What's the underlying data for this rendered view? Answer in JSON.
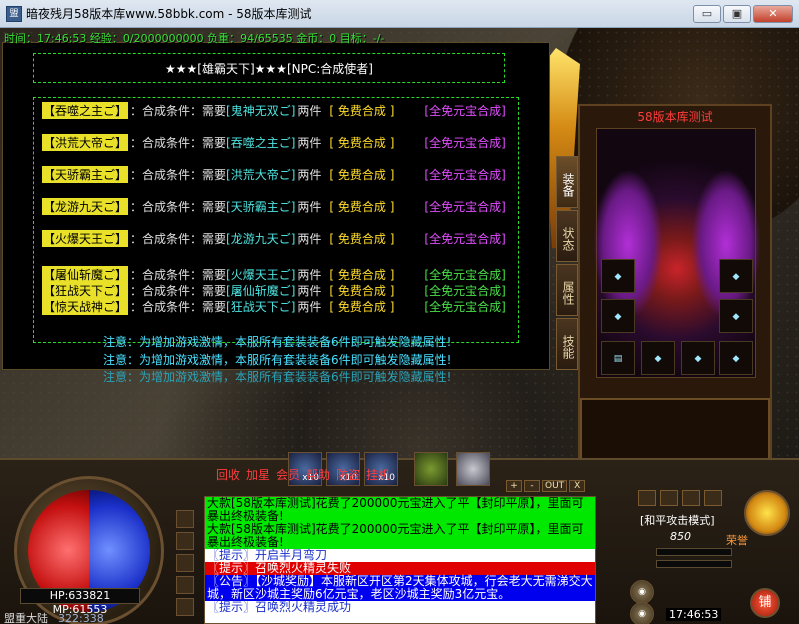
{
  "window": {
    "title": "暗夜残月58版本库www.58bbk.com - 58版本库测试",
    "buttons": {
      "minimize": "▭",
      "maximize": "▣",
      "close": "✕"
    }
  },
  "status_line": "时间：17:46:53 经验：0/2000000000 负重：94/65535 金币：0 目标：-/-",
  "npc_dialog": {
    "header": "★★★[雄霸天下]★★★[NPC:合成使者]",
    "rows": [
      {
        "name": "【吞噬之主ご】",
        "cond": "：合成条件：需要",
        "mat": "[鬼神无双ご]",
        "count": "两件",
        "free": "[ 免费合成 ]",
        "allfree": "[全免元宝合成]",
        "allfree_color": "#e34dff"
      },
      {
        "name": "【洪荒大帝ご】",
        "cond": "：合成条件：需要",
        "mat": "[吞噬之主ご]",
        "count": "两件",
        "free": "[ 免费合成 ]",
        "allfree": "[全免元宝合成]",
        "allfree_color": "#e34dff"
      },
      {
        "name": "【天骄霸主ご】",
        "cond": "：合成条件：需要",
        "mat": "[洪荒大帝ご]",
        "count": "两件",
        "free": "[ 免费合成 ]",
        "allfree": "[全免元宝合成]",
        "allfree_color": "#e34dff"
      },
      {
        "name": "【龙游九天ご】",
        "cond": "：合成条件：需要",
        "mat": "[天骄霸主ご]",
        "count": "两件",
        "free": "[ 免费合成 ]",
        "allfree": "[全免元宝合成]",
        "allfree_color": "#e34dff"
      },
      {
        "name": "【火爆天王ご】",
        "cond": "：合成条件：需要",
        "mat": "[龙游九天ご]",
        "count": "两件",
        "free": "[ 免费合成 ]",
        "allfree": "[全免元宝合成]",
        "allfree_color": "#e34dff"
      },
      {
        "name": "【屠仙斩魔ご】",
        "cond": "：合成条件：需要",
        "mat": "[火爆天王ご]",
        "count": "两件",
        "free": "[ 免费合成 ]",
        "allfree": "[全免元宝合成]",
        "allfree_color": "#48e048"
      },
      {
        "name": "【狂战天下ご】",
        "cond": "：合成条件：需要",
        "mat": "[屠仙斩魔ご]",
        "count": "两件",
        "free": "[ 免费合成 ]",
        "allfree": "[全免元宝合成]",
        "allfree_color": "#48e048"
      },
      {
        "name": "【惊天战神ご】",
        "cond": "：合成条件：需要",
        "mat": "[狂战天下ご]",
        "count": "两件",
        "free": "[ 免费合成 ]",
        "allfree": "[全免元宝合成]",
        "allfree_color": "#48e048"
      }
    ],
    "notices": [
      "注意：为增加游戏激情，本服所有套装装备6件即可触发隐藏属性!",
      "注意：为增加游戏激情，本服所有套装装备6件即可触发隐藏属性!",
      "注意：为增加游戏激情，本服所有套装装备6件即可触发隐藏属性!"
    ]
  },
  "equipment": {
    "title": "58版本库测试",
    "tabs": [
      "装备",
      "状态",
      "属性",
      "技能"
    ]
  },
  "hud": {
    "hp_mp": "HP:633821  MP:61553",
    "map_name": "盟重大陆",
    "map_coords": "322:338",
    "quick_slots": [
      {
        "label": "x10",
        "style": "blue"
      },
      {
        "label": "x10",
        "style": "blue"
      },
      {
        "label": "x10",
        "style": "blue"
      },
      {
        "label": "",
        "style": "green"
      },
      {
        "label": "",
        "style": "gray"
      }
    ]
  },
  "chat": {
    "menu": [
      "回收",
      "加星",
      "会员",
      "帮助",
      "防盗",
      "挂机"
    ],
    "tools": [
      "+",
      "-",
      "OUT",
      "X"
    ],
    "messages": [
      {
        "text": "大款[58版本库测试]花费了200000元宝进入了平【封印平原】，里面可暴出终极装备!",
        "style": "green"
      },
      {
        "text": "大款[58版本库测试]花费了200000元宝进入了平【封印平原】，里面可暴出终极装备!",
        "style": "green"
      },
      {
        "text": "〖提示〗开启半月弯刀",
        "style": "sys"
      },
      {
        "text": "〖提示〗召唤烈火精灵失败",
        "style": "red"
      },
      {
        "text": "〖公告〗【沙城奖励】本服新区开区第2天集体攻城，行会老大无需涕交大城，新区沙城主奖励6亿元宝，老区沙城主奖励3亿元宝。",
        "style": "blue"
      },
      {
        "text": "〖提示〗召唤烈火精灵成功",
        "style": "sys2"
      }
    ]
  },
  "right_hud": {
    "attack_mode": "[和平攻击模式]",
    "level": "850",
    "honor": "荣誉",
    "shop": "铺",
    "clock": "17:46:53"
  }
}
